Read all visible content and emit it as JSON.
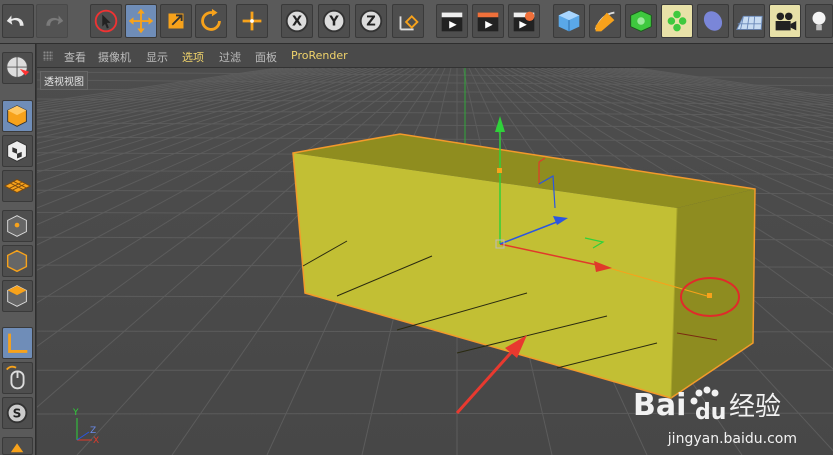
{
  "toolbar": {
    "axis_x": "X",
    "axis_y": "Y",
    "axis_z": "Z"
  },
  "viewport_menu": {
    "items": [
      "查看",
      "摄像机",
      "显示",
      "选项",
      "过滤",
      "面板",
      "ProRender"
    ],
    "selected": "选项"
  },
  "viewport": {
    "label": "透视视图"
  },
  "axis_gizmo": {
    "x": "X",
    "y": "Y",
    "z": "Z"
  },
  "watermark": {
    "logo_text": "Bai",
    "logo_text2": "du",
    "logo_cn": "经验",
    "url": "jingyan.baidu.com"
  },
  "colors": {
    "object_fill": "#c8c531",
    "object_edge": "#f39a2b",
    "axis_x": "#e03a2a",
    "axis_y": "#2fd13a",
    "axis_z": "#2b56e0",
    "annotation": "#e02a2a",
    "active_tool": "#6f8db8"
  }
}
